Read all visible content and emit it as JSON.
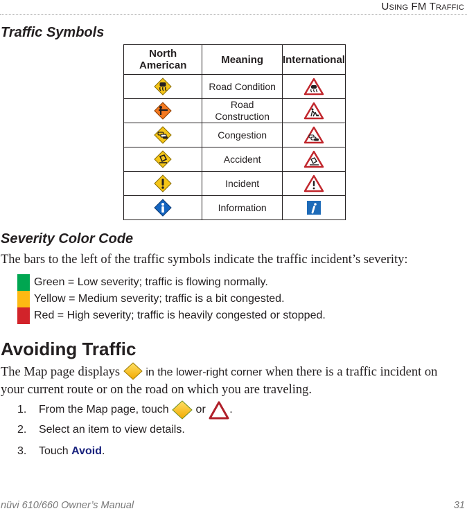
{
  "header": {
    "running_title": "Using FM Traffic"
  },
  "traffic_symbols": {
    "title": "Traffic Symbols",
    "columns": [
      "North American",
      "Meaning",
      "International"
    ],
    "rows": [
      {
        "meaning": "Road Condition",
        "na_icon": "road-condition-diamond-icon",
        "intl_icon": "road-condition-triangle-icon"
      },
      {
        "meaning": "Road Construction",
        "na_icon": "road-construction-diamond-icon",
        "intl_icon": "road-construction-triangle-icon"
      },
      {
        "meaning": "Congestion",
        "na_icon": "congestion-diamond-icon",
        "intl_icon": "congestion-triangle-icon"
      },
      {
        "meaning": "Accident",
        "na_icon": "accident-diamond-icon",
        "intl_icon": "accident-triangle-icon"
      },
      {
        "meaning": "Incident",
        "na_icon": "incident-diamond-icon",
        "intl_icon": "incident-triangle-icon"
      },
      {
        "meaning": "Information",
        "na_icon": "information-diamond-icon",
        "intl_icon": "information-square-icon"
      }
    ]
  },
  "severity": {
    "title": "Severity Color Code",
    "intro": "The bars to the left of the traffic symbols indicate the traffic incident’s severity:",
    "levels": [
      {
        "color": "#00a651",
        "text": "Green = Low severity; traffic is flowing normally."
      },
      {
        "color": "#fdb913",
        "text": "Yellow = Medium severity; traffic is a bit congested."
      },
      {
        "color": "#d2232a",
        "text": "Red = High severity; traffic is heavily congested or stopped."
      }
    ]
  },
  "avoiding": {
    "title": "Avoiding Traffic",
    "p1_before": "The Map page displays ",
    "p1_highlight": "in the lower-right corner",
    "p1_after": " when there is a traffic incident on",
    "p2": "your current route or on the road on which you are traveling.",
    "steps": [
      {
        "num": "1.",
        "text_before": "From the Map page, touch ",
        "text_mid": " or ",
        "text_after": "."
      },
      {
        "num": "2.",
        "text": "Select an item to view details."
      },
      {
        "num": "3.",
        "text_before": "Touch ",
        "link": "Avoid",
        "text_after": "."
      }
    ]
  },
  "footer": {
    "manual": "nüvi 610/660 Owner’s Manual",
    "page": "31"
  }
}
